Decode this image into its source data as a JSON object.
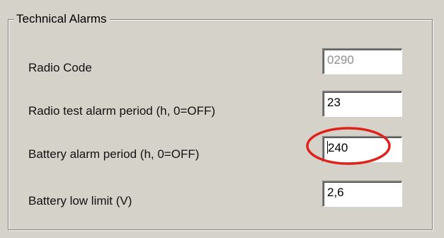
{
  "group": {
    "title": "Technical Alarms"
  },
  "fields": [
    {
      "label": "Radio Code",
      "value": "0290"
    },
    {
      "label": "Radio test alarm period (h, 0=OFF)",
      "value": "23"
    },
    {
      "label": "Battery alarm period (h, 0=OFF)",
      "value": "240"
    },
    {
      "label": "Battery low limit (V)",
      "value": "2,6"
    }
  ],
  "colors": {
    "background": "#d5d2ca",
    "highlight_ellipse": "#e0201a",
    "disabled_text": "#8e8e8e"
  }
}
